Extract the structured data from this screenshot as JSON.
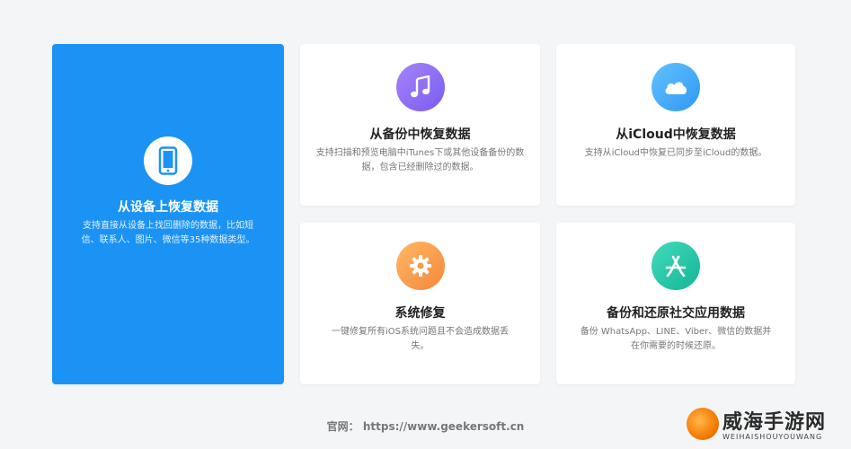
{
  "cards": {
    "device": {
      "title": "从设备上恢复数据",
      "desc_line1": "支持直接从设备上找回删除的数据，比如短",
      "desc_line2": "信、联系人、图片、微信等35种数据类型。",
      "icon": "phone-icon"
    },
    "backup": {
      "title": "从备份中恢复数据",
      "desc_line1": "支持扫描和预览电脑中iTunes下或其他设备备份的数",
      "desc_line2": "据，包含已经删除过的数据。",
      "icon": "music-note-icon"
    },
    "icloud": {
      "title": "从iCloud中恢复数据",
      "desc_line1": "支持从iCloud中恢复已同步至iCloud的数据。",
      "icon": "cloud-icon"
    },
    "repair": {
      "title": "系统修复",
      "desc_line1": "一键修复所有iOS系统问题且不会造成数据丢",
      "desc_line2": "失。",
      "icon": "gear-icon"
    },
    "social": {
      "title": "备份和还原社交应用数据",
      "desc_line1": "备份 WhatsApp、LINE、Viber、微信的数据并",
      "desc_line2": "在你需要的时候还原。",
      "icon": "app-store-icon"
    }
  },
  "footer": {
    "label": "官网：",
    "url": "https://www.geekersoft.cn"
  },
  "watermark": {
    "text": "威海手游网",
    "sub": "WEIHAISHOUYOUWANG"
  },
  "colors": {
    "primary": "#1b93f5",
    "music_gradient": [
      "#9b7cf7",
      "#7b5cf0"
    ],
    "cloud_gradient": [
      "#5cbcff",
      "#2f9bf5"
    ],
    "gear_gradient": [
      "#ffb05a",
      "#f58b3a"
    ],
    "app_gradient": [
      "#3fd7b8",
      "#16b79b"
    ]
  }
}
